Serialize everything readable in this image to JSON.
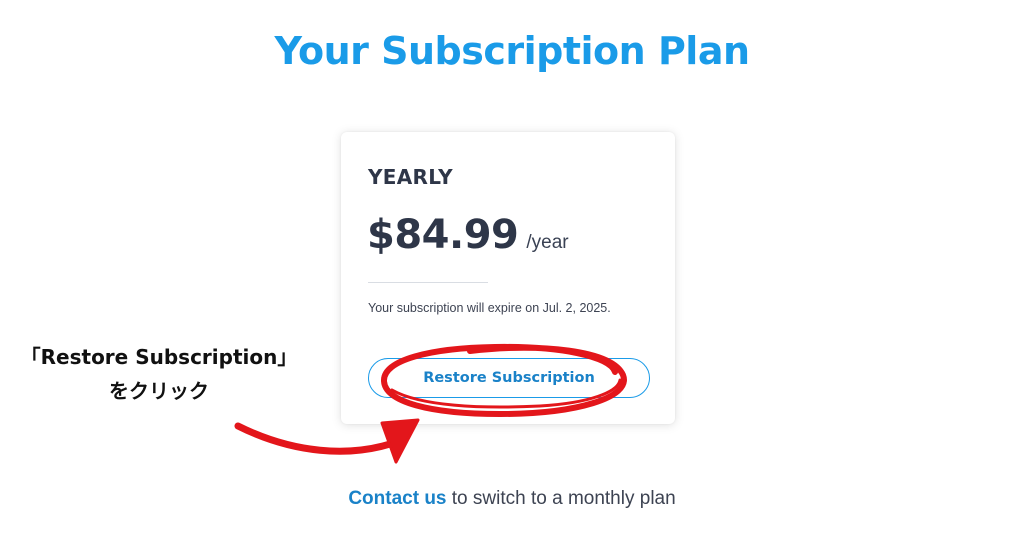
{
  "page": {
    "title": "Your Subscription Plan"
  },
  "plan": {
    "name": "YEARLY",
    "price": "$84.99",
    "period": "/year",
    "expire_text": "Your subscription will expire on Jul. 2, 2025.",
    "restore_label": "Restore Subscription"
  },
  "footer": {
    "contact_link": "Contact us",
    "contact_suffix": " to switch to a monthly plan"
  },
  "annotation": {
    "line1": "「Restore Subscription」",
    "line2": "をクリック",
    "highlight_color": "#e3161b"
  },
  "colors": {
    "accent": "#1a9be8",
    "text_dark": "#2e3648"
  }
}
